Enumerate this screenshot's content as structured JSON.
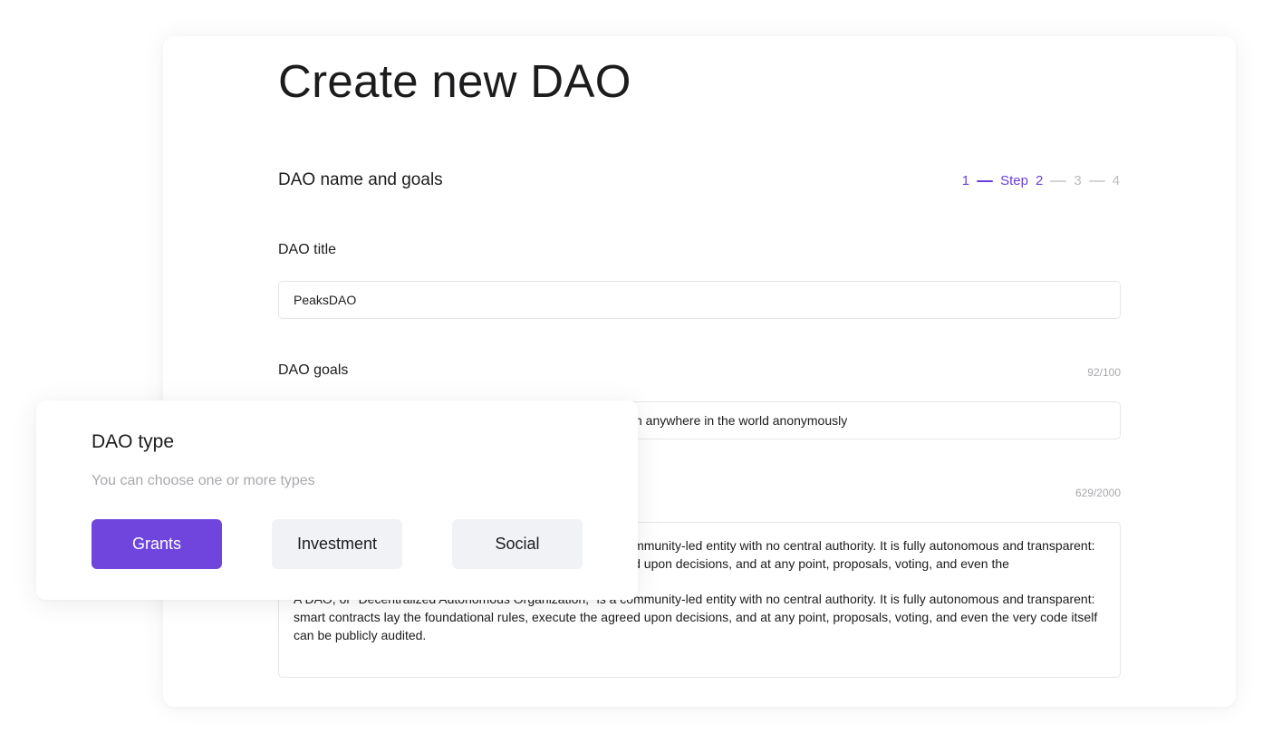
{
  "page": {
    "title": "Create new DAO",
    "section_title": "DAO name and goals"
  },
  "stepper": {
    "prev_step": "1",
    "step_label": "Step",
    "current_step": "2",
    "next_step_3": "3",
    "next_step_4": "4"
  },
  "fields": {
    "title_label": "DAO title",
    "title_value": "PeaksDAO",
    "goals_label": "DAO goals",
    "goals_counter": "92/100",
    "goals_value_visible": "n anywhere in the world anonymously",
    "description_counter": "629/2000",
    "description_paragraphs": [
      "A DAO, or “Decentralized Autonomous Organization,” is a community-led entity with no central authority. It is fully autonomous and transparent: smart contracts lay the foundational rules, execute the agreed upon decisions, and at any point, proposals, voting, and even the",
      "A DAO, or “Decentralized Autonomous Organization,” is a community-led entity with no central authority. It is fully autonomous and transparent: smart contracts lay the foundational rules, execute the agreed upon decisions, and at any point, proposals, voting, and even the very code itself can be publicly audited."
    ]
  },
  "dao_type": {
    "title": "DAO type",
    "hint": "You can choose one or more types",
    "options": [
      {
        "label": "Grants",
        "selected": true
      },
      {
        "label": "Investment",
        "selected": false
      },
      {
        "label": "Social",
        "selected": false
      }
    ]
  },
  "colors": {
    "accent": "#6f45de",
    "stepper_active": "#6a3fdc",
    "stepper_inactive": "#bdbdc2",
    "option_unselected_bg": "#f1f2f5"
  }
}
